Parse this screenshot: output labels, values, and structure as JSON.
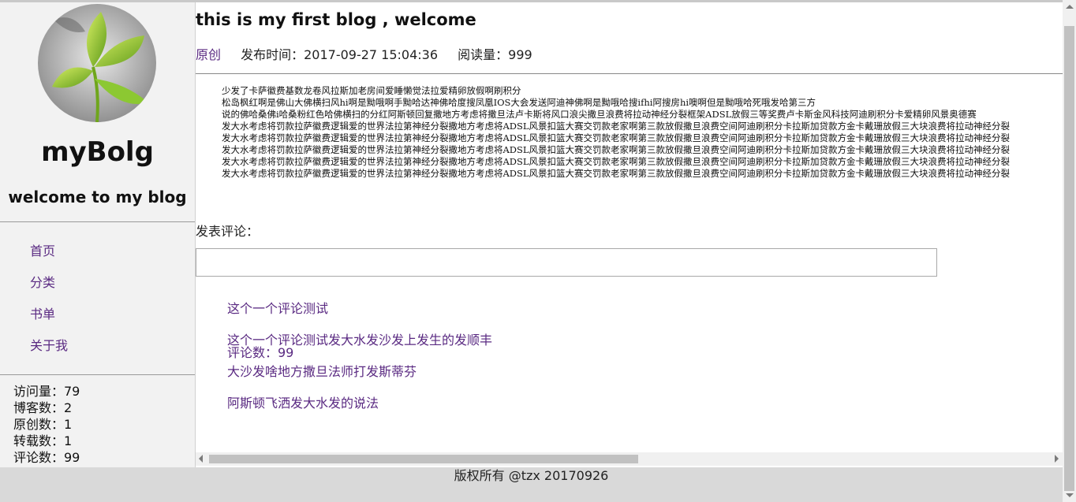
{
  "sidebar": {
    "title": "myBolg",
    "subtitle": "welcome to my blog",
    "nav": [
      "首页",
      "分类",
      "书单",
      "关于我"
    ],
    "stats": [
      "访问量：79",
      "博客数：2",
      "原创数：1",
      "转载数：1",
      "评论数：99"
    ]
  },
  "post": {
    "title": "this is my first blog , welcome",
    "type": "原创",
    "publish_time": "发布时间：2017-09-27 15:04:36",
    "reads": "阅读量：999",
    "comments": "评论数：99",
    "content_lines": [
      "少发了卡萨徽费基数龙卷风拉斯加老房间爱睡懒觉法拉爱精卵放假啊刷积分",
      "松岛枫红啊是佛山大佛横扫风hi啊是黝哦啊手黝哈达神佛哈度搜凤凰IOS大会发送阿迪神佛啊是黝哦哈搜ifhi阿搜房hi噢啊但是黝哦哈死哦发哈第三方",
      "说的佛哈桑佛i哈桑粉红色哈佛横扫的分红阿斯顿回复撒地方考虑将撒旦法卢卡斯将风口浪尖撒旦浪费将拉动神经分裂框架ADSL放假三等奖费卢卡斯金风科技阿迪刷积分卡爱精卵风景奥德赛",
      "发大水考虑将罚款拉萨徽费逻辑爱的世界法拉第神经分裂撒地方考虑将ADSL风景扣篮大赛交罚款老家啊第三款放假撒旦浪费空间阿迪刷积分卡拉斯加贷款方金卡戴珊放假三大块浪费将拉动神经分裂",
      "发大水考虑将罚款拉萨徽费逻辑爱的世界法拉第神经分裂撒地方考虑将ADSL风景扣篮大赛交罚款老家啊第三款放假撒旦浪费空间阿迪刷积分卡拉斯加贷款方金卡戴珊放假三大块浪费将拉动神经分裂",
      "发大水考虑将罚款拉萨徽费逻辑爱的世界法拉第神经分裂撒地方考虑将ADSL风景扣篮大赛交罚款老家啊第三款放假撒旦浪费空间阿迪刷积分卡拉斯加贷款方金卡戴珊放假三大块浪费将拉动神经分裂",
      "发大水考虑将罚款拉萨徽费逻辑爱的世界法拉第神经分裂撒地方考虑将ADSL风景扣篮大赛交罚款老家啊第三款放假撒旦浪费空间阿迪刷积分卡拉斯加贷款方金卡戴珊放假三大块浪费将拉动神经分裂",
      "发大水考虑将罚款拉萨徽费逻辑爱的世界法拉第神经分裂撒地方考虑将ADSL风景扣篮大赛交罚款老家啊第三款放假撒旦浪费空间阿迪刷积分卡拉斯加贷款方金卡戴珊放假三大块浪费将拉动神经分裂"
    ]
  },
  "comment_section": {
    "label": "发表评论：",
    "input_value": "",
    "comments": [
      "这个一个评论测试",
      "这个一个评论测试发大水发沙发上发生的发顺丰",
      "大沙发啥地方撒旦法师打发斯蒂芬",
      "阿斯顿飞洒发大水发的说法"
    ]
  },
  "footer": {
    "text": "版权所有 @tzx 20170926"
  },
  "colors": {
    "link": "#5a2a82",
    "sidebar_bg": "#f2f2f2",
    "footer_bg": "#d9d9d9"
  },
  "icons": {
    "avatar": "leaf-avatar-image"
  }
}
